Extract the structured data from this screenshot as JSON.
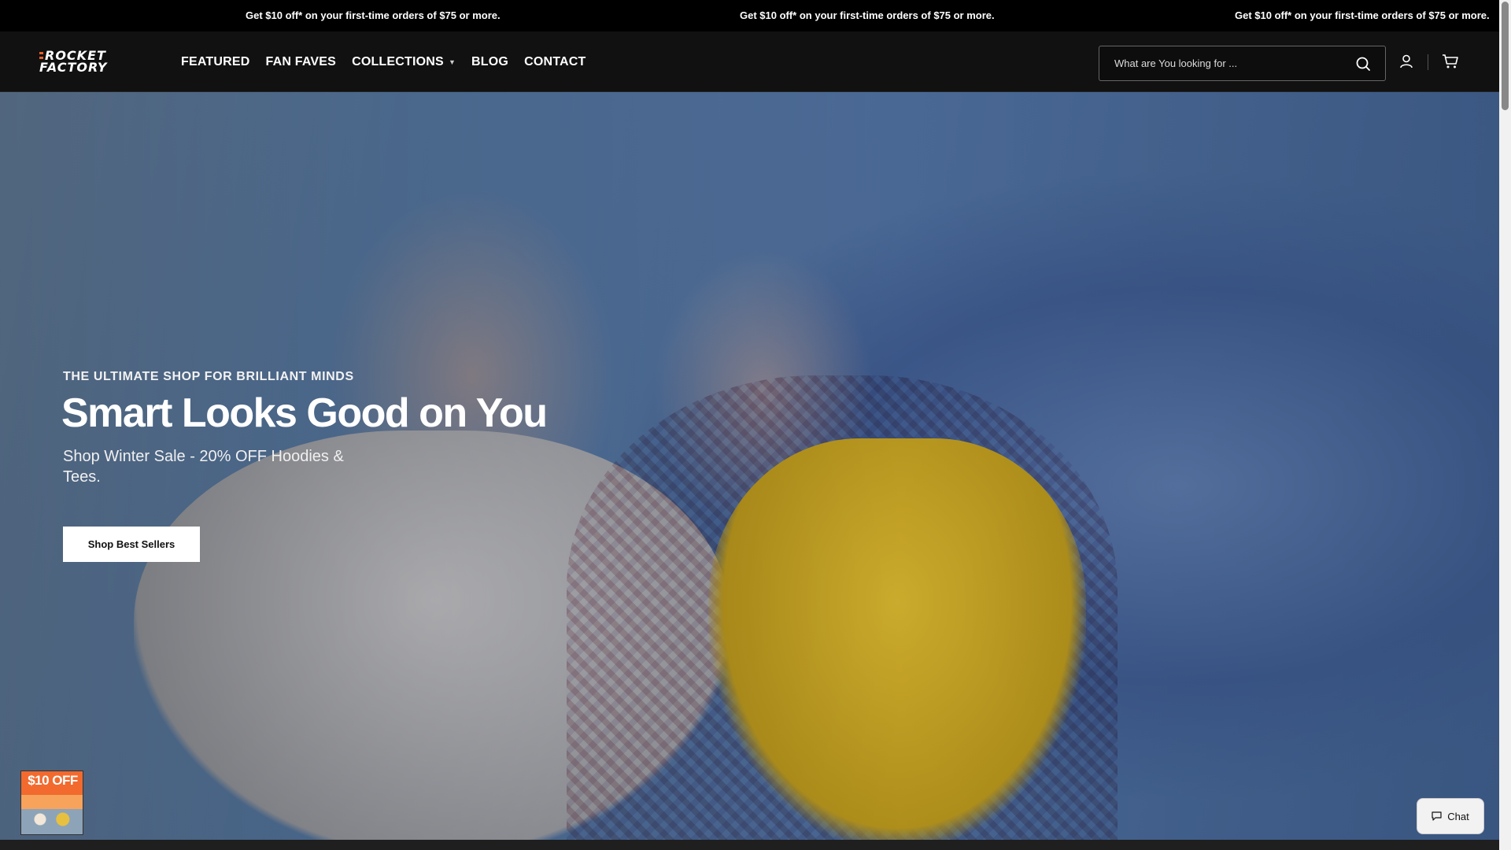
{
  "announcement": {
    "items": [
      "Get $10 off* on your first-time orders of $75 or more.",
      "Get $10 off* on your first-time orders of $75 or more.",
      "Get $10 off* on your first-time orders of $75 or more."
    ]
  },
  "header": {
    "logo": {
      "line1": "ROCKET",
      "line2": "FACTORY"
    },
    "nav": [
      {
        "label": "FEATURED"
      },
      {
        "label": "FAN FAVES"
      },
      {
        "label": "COLLECTIONS",
        "has_dropdown": true
      },
      {
        "label": "BLOG"
      },
      {
        "label": "CONTACT"
      }
    ],
    "search": {
      "placeholder": "What are You looking for ...",
      "value": ""
    },
    "icons": {
      "search": "search-icon",
      "account": "account-icon",
      "cart": "cart-icon"
    }
  },
  "hero": {
    "eyebrow": "THE ULTIMATE SHOP FOR BRILLIANT MINDS",
    "title": "Smart Looks Good on You",
    "subtitle": "Shop Winter Sale - 20% OFF Hoodies & Tees.",
    "cta": "Shop Best Sellers"
  },
  "promo": {
    "label": "$10 OFF"
  },
  "chat": {
    "label": "Chat"
  },
  "colors": {
    "brand_accent": "#e85d24",
    "header_bg": "#111111",
    "announce_bg": "#000000"
  }
}
